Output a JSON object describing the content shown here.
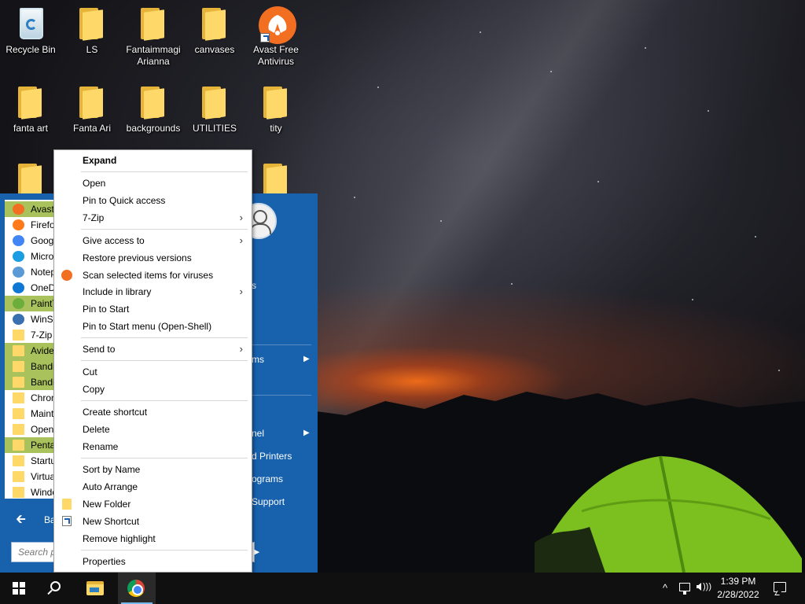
{
  "desktop": {
    "icons": [
      {
        "label": "Recycle Bin",
        "icon": "recycle-bin-icon"
      },
      {
        "label": "LS",
        "icon": "folder-icon"
      },
      {
        "label": "Fantaimmagi Arianna",
        "icon": "folder-icon"
      },
      {
        "label": "canvases",
        "icon": "folder-icon"
      },
      {
        "label": "Avast Free Antivirus",
        "icon": "avast-icon"
      },
      {
        "label": "fanta art",
        "icon": "folder-icon"
      },
      {
        "label": "Fanta Ari",
        "icon": "folder-icon"
      },
      {
        "label": "backgrounds",
        "icon": "folder-icon"
      },
      {
        "label": "UTILITIES",
        "icon": "folder-icon"
      },
      {
        "label": "tity",
        "icon": "folder-icon"
      }
    ]
  },
  "start_menu": {
    "programs": [
      {
        "label": "Avast",
        "highlight": true,
        "icon": "avast-icon",
        "color": "#f26f22"
      },
      {
        "label": "Firefo",
        "highlight": false,
        "icon": "firefox-icon",
        "color": "#ff7a1a"
      },
      {
        "label": "Goog",
        "highlight": false,
        "icon": "chrome-icon",
        "color": "#4285f4"
      },
      {
        "label": "Micro",
        "highlight": false,
        "icon": "edge-icon",
        "color": "#1b9de2"
      },
      {
        "label": "Notep",
        "highlight": false,
        "icon": "notepad-icon",
        "color": "#5b9bd5"
      },
      {
        "label": "OneD",
        "highlight": false,
        "icon": "onedrive-icon",
        "color": "#0f78d4"
      },
      {
        "label": "PaintT",
        "highlight": true,
        "icon": "paint-icon",
        "color": "#6cae3d"
      },
      {
        "label": "WinSC",
        "highlight": false,
        "icon": "winscp-icon",
        "color": "#3a6fb0"
      },
      {
        "label": "7-Zip",
        "highlight": false,
        "icon": "folder-icon",
        "color": "#ffd86a"
      },
      {
        "label": "Avide",
        "highlight": true,
        "icon": "folder-icon",
        "color": "#ffd86a"
      },
      {
        "label": "Bandi",
        "highlight": true,
        "icon": "folder-icon",
        "color": "#ffd86a"
      },
      {
        "label": "Bandi",
        "highlight": true,
        "icon": "folder-icon",
        "color": "#ffd86a"
      },
      {
        "label": "Chron",
        "highlight": false,
        "icon": "folder-icon",
        "color": "#ffd86a"
      },
      {
        "label": "Maint",
        "highlight": false,
        "icon": "folder-icon",
        "color": "#ffd86a"
      },
      {
        "label": "Open",
        "highlight": false,
        "icon": "folder-icon",
        "color": "#ffd86a"
      },
      {
        "label": "Penta",
        "highlight": true,
        "icon": "folder-icon",
        "color": "#ffd86a"
      },
      {
        "label": "Startu",
        "highlight": false,
        "icon": "folder-icon",
        "color": "#ffd86a"
      },
      {
        "label": "Virtua",
        "highlight": false,
        "icon": "folder-icon",
        "color": "#ffd86a"
      },
      {
        "label": "Windo",
        "highlight": false,
        "icon": "folder-icon",
        "color": "#ffd86a"
      }
    ],
    "back_label": "Ba",
    "search_placeholder": "Search p",
    "right_items": {
      "item_a": "s",
      "item_b": "ms",
      "item_c": "nel",
      "item_d": "d Printers",
      "item_e": "ograms",
      "item_f": "Support"
    }
  },
  "context_menu": {
    "expand": "Expand",
    "open": "Open",
    "pin_quick": "Pin to Quick access",
    "seven_zip": "7-Zip",
    "give_access": "Give access to",
    "restore_versions": "Restore previous versions",
    "scan_viruses": "Scan selected items for viruses",
    "include_library": "Include in library",
    "pin_start": "Pin to Start",
    "pin_start_openshell": "Pin to Start menu (Open-Shell)",
    "send_to": "Send to",
    "cut": "Cut",
    "copy": "Copy",
    "create_shortcut": "Create shortcut",
    "delete": "Delete",
    "rename": "Rename",
    "sort_by_name": "Sort by Name",
    "auto_arrange": "Auto Arrange",
    "new_folder": "New Folder",
    "new_shortcut": "New Shortcut",
    "remove_highlight": "Remove highlight",
    "properties": "Properties",
    "submenu_glyph": "›"
  },
  "taskbar": {
    "time": "1:39 PM",
    "date": "2/28/2022",
    "tray_chevron": "^"
  },
  "colors": {
    "start_menu_blue": "#1761ad",
    "highlight_green": "#a9c25b",
    "taskbar": "#101010"
  }
}
